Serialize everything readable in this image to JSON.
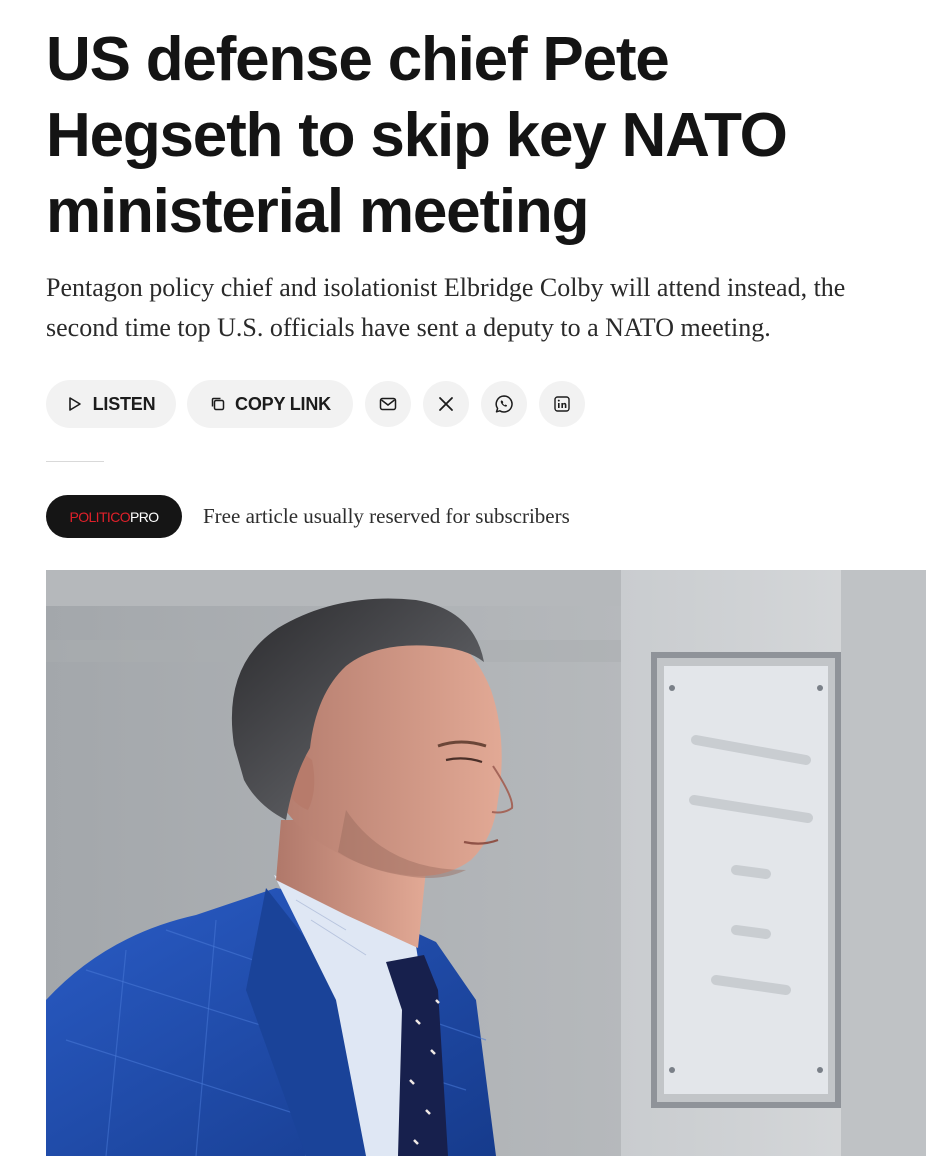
{
  "article": {
    "headline": "US defense chief Pete Hegseth to skip key NATO ministerial meeting",
    "dek": "Pentagon policy chief and isolationist Elbridge Colby will attend instead, the second time top U.S. officials have sent a deputy to a NATO meeting."
  },
  "actions": {
    "listen_label": "LISTEN",
    "copy_link_label": "COPY LINK",
    "icons": [
      "play-icon",
      "copy-icon",
      "email-icon",
      "x-icon",
      "whatsapp-icon",
      "linkedin-icon"
    ]
  },
  "pro_banner": {
    "badge_brand": "POLITICO",
    "badge_suffix": "PRO",
    "note": "Free article usually reserved for subscribers"
  },
  "colors": {
    "brand_red": "#e0202a",
    "badge_bg": "#151515",
    "pill_bg": "#f2f2f2",
    "suit_blue": "#1f4aa8"
  }
}
